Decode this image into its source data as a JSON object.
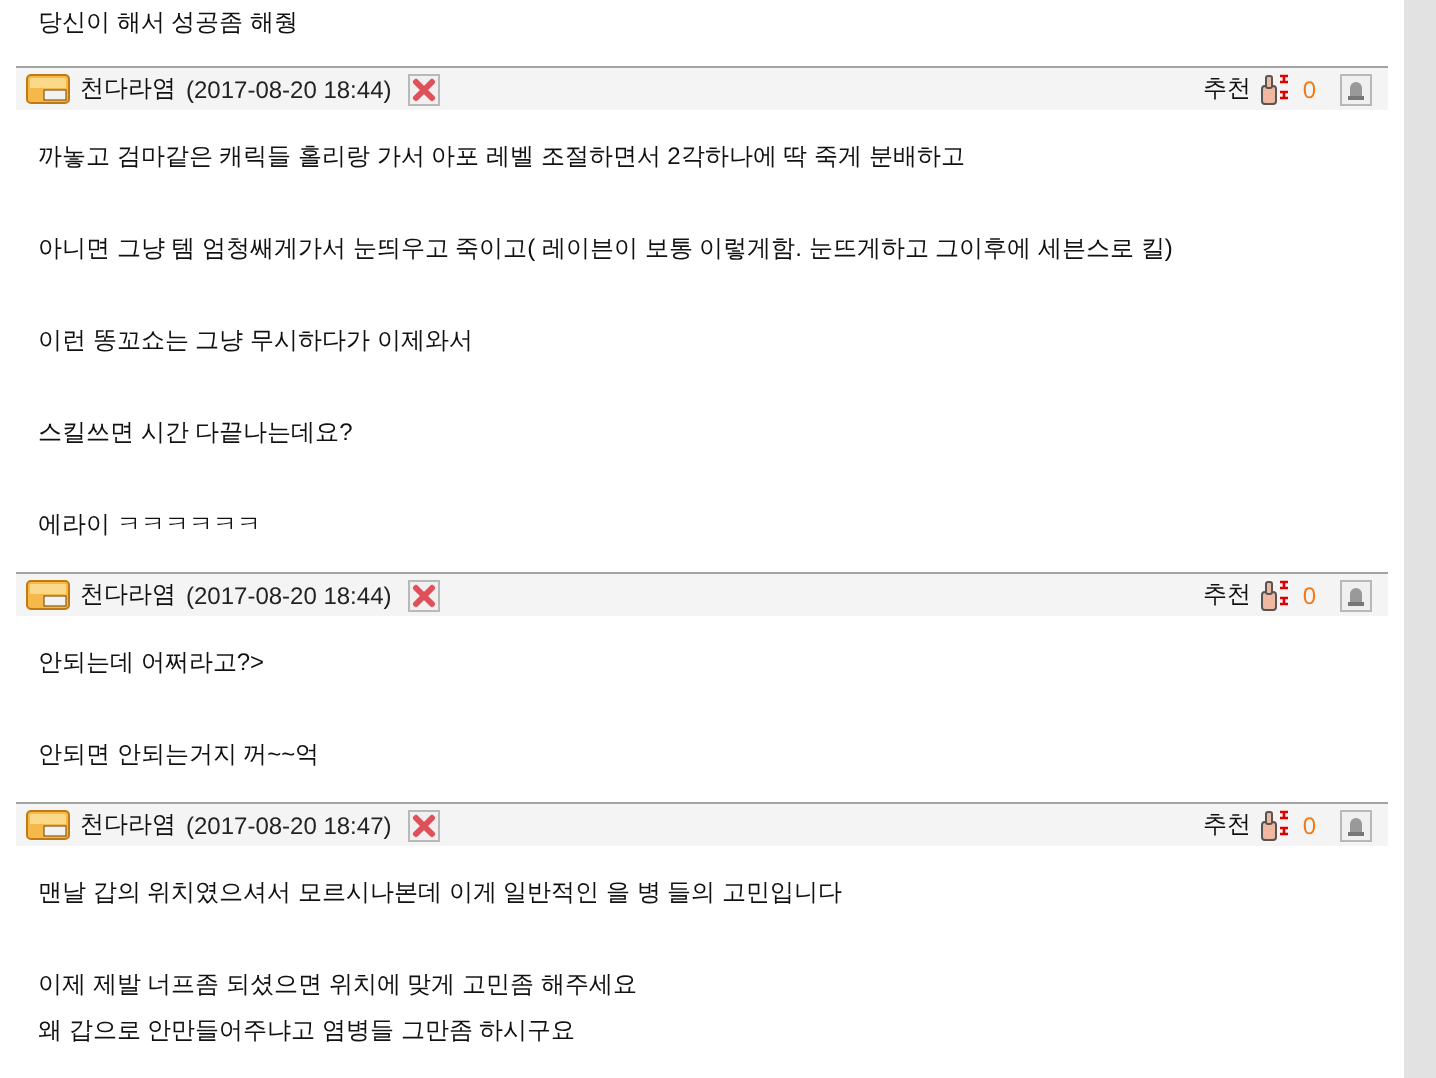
{
  "previous_comment_tail": {
    "paragraphs": [
      [
        "당신이 해서 성공좀 해줭"
      ]
    ]
  },
  "comments": [
    {
      "author": "천다라염",
      "time": "(2017-08-20 18:44)",
      "recommend_label": "추천",
      "recommend_count": "0",
      "paragraphs": [
        [
          "까놓고 검마같은 캐릭들 홀리랑 가서 아포 레벨 조절하면서 2각하나에 딱 죽게 분배하고"
        ],
        [
          "아니면 그냥 템 엄청쌔게가서 눈띄우고 죽이고( 레이븐이 보통 이렇게함. 눈뜨게하고 그이후에 세븐스로 킬)"
        ],
        [
          "이런 똥꼬쇼는 그냥 무시하다가 이제와서"
        ],
        [
          "스킬쓰면 시간 다끝나는데요?"
        ],
        [
          "에라이 ㅋㅋㅋㅋㅋㅋ"
        ]
      ]
    },
    {
      "author": "천다라염",
      "time": "(2017-08-20 18:44)",
      "recommend_label": "추천",
      "recommend_count": "0",
      "paragraphs": [
        [
          "안되는데 어쩌라고?>"
        ],
        [
          "안되면 안되는거지 꺼~~억"
        ]
      ]
    },
    {
      "author": "천다라염",
      "time": "(2017-08-20 18:47)",
      "recommend_label": "추천",
      "recommend_count": "0",
      "paragraphs": [
        [
          "맨날 갑의 위치였으셔서 모르시나본데 이게 일반적인 을 병 들의 고민입니다"
        ],
        [
          "이제 제발 너프좀 되셨으면 위치에 맞게 고민좀 해주세요",
          "왜 갑으로 안만들어주냐고 염병들 그만좀 하시구요"
        ]
      ]
    }
  ]
}
